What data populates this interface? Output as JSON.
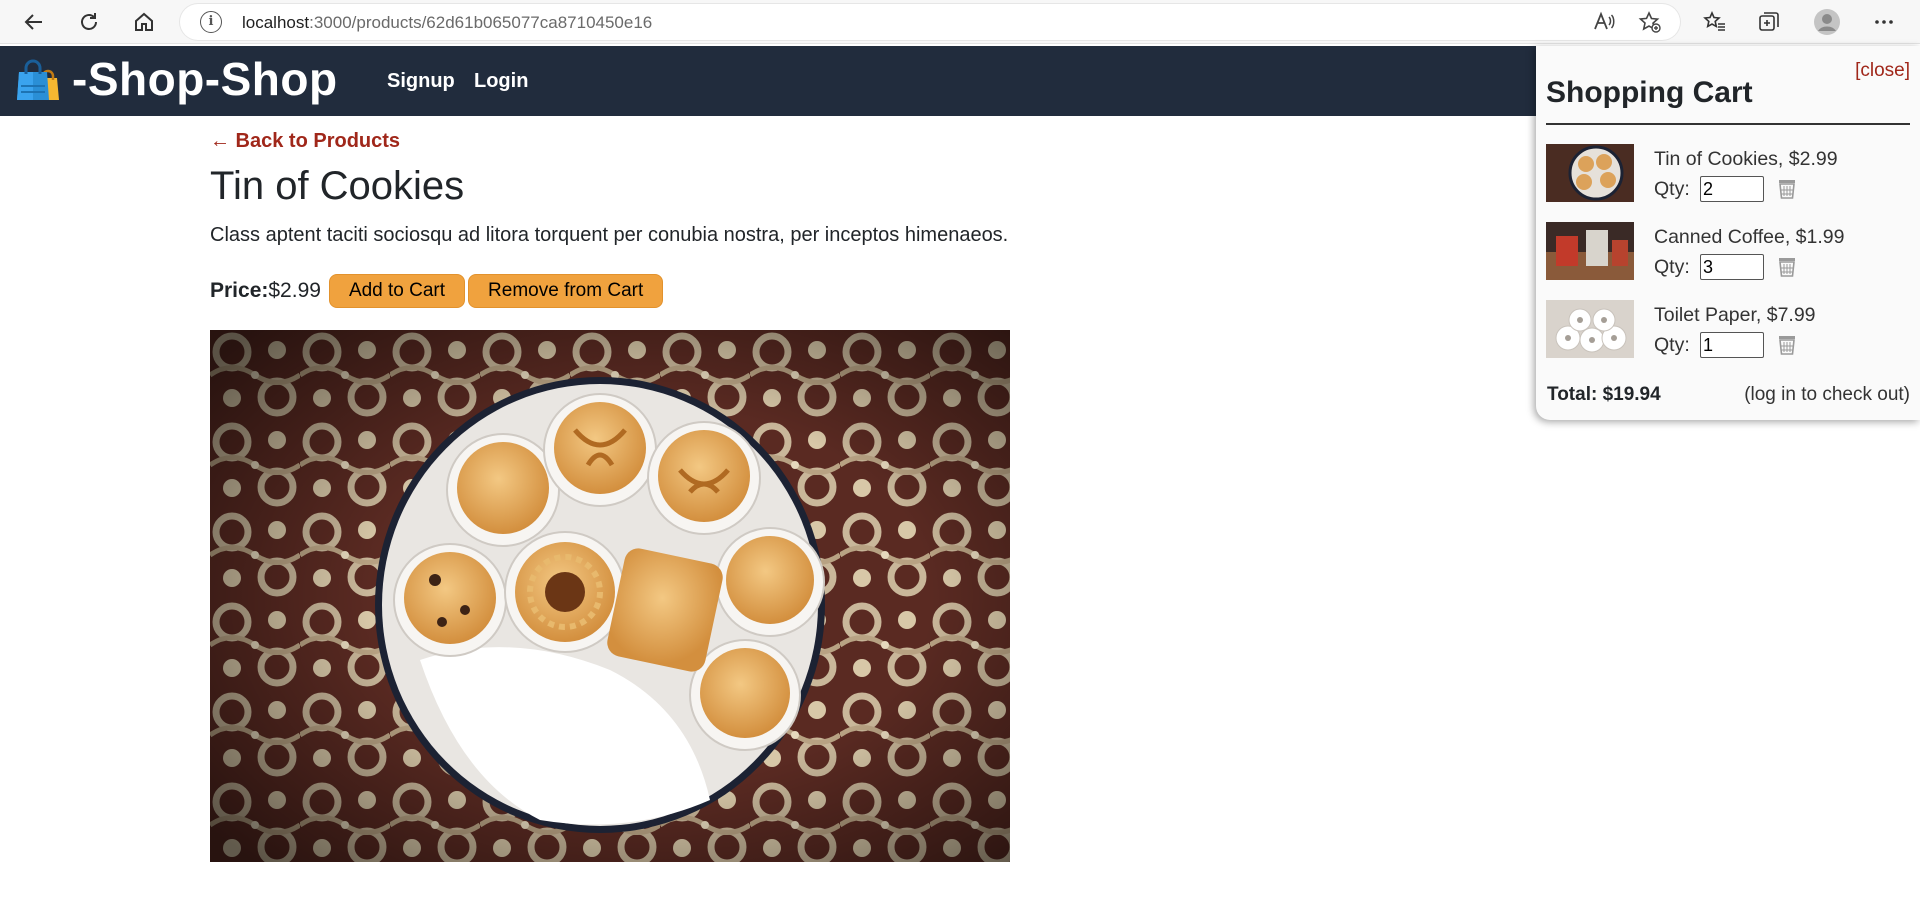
{
  "browser": {
    "url_host": "localhost",
    "url_path": ":3000/products/62d61b065077ca8710450e16",
    "icons": [
      "back-arrow-icon",
      "refresh-icon",
      "home-icon",
      "info-icon",
      "read-aloud-icon",
      "favorite-add-icon",
      "favorites-icon",
      "collections-icon",
      "profile-icon",
      "more-icon"
    ]
  },
  "header": {
    "brand": "-Shop-Shop",
    "nav": {
      "signup": "Signup",
      "login": "Login"
    }
  },
  "product": {
    "back_link": "← Back to Products",
    "name": "Tin of Cookies",
    "description": "Class aptent taciti sociosqu ad litora torquent per conubia nostra, per inceptos himenaeos.",
    "price_label": "Price:",
    "price": "$2.99",
    "add_button": "Add to Cart",
    "remove_button": "Remove from Cart"
  },
  "cart": {
    "close": "[close]",
    "title": "Shopping Cart",
    "qty_label": "Qty:",
    "items": [
      {
        "name": "Tin of Cookies, $2.99",
        "qty": "2"
      },
      {
        "name": "Canned Coffee, $1.99",
        "qty": "3"
      },
      {
        "name": "Toilet Paper, $7.99",
        "qty": "1"
      }
    ],
    "total": "Total: $19.94",
    "login_note": "(log in to check out)"
  },
  "colors": {
    "header_bg": "#212c3d",
    "accent_link": "#a0271a",
    "button": "#f0a23e"
  }
}
